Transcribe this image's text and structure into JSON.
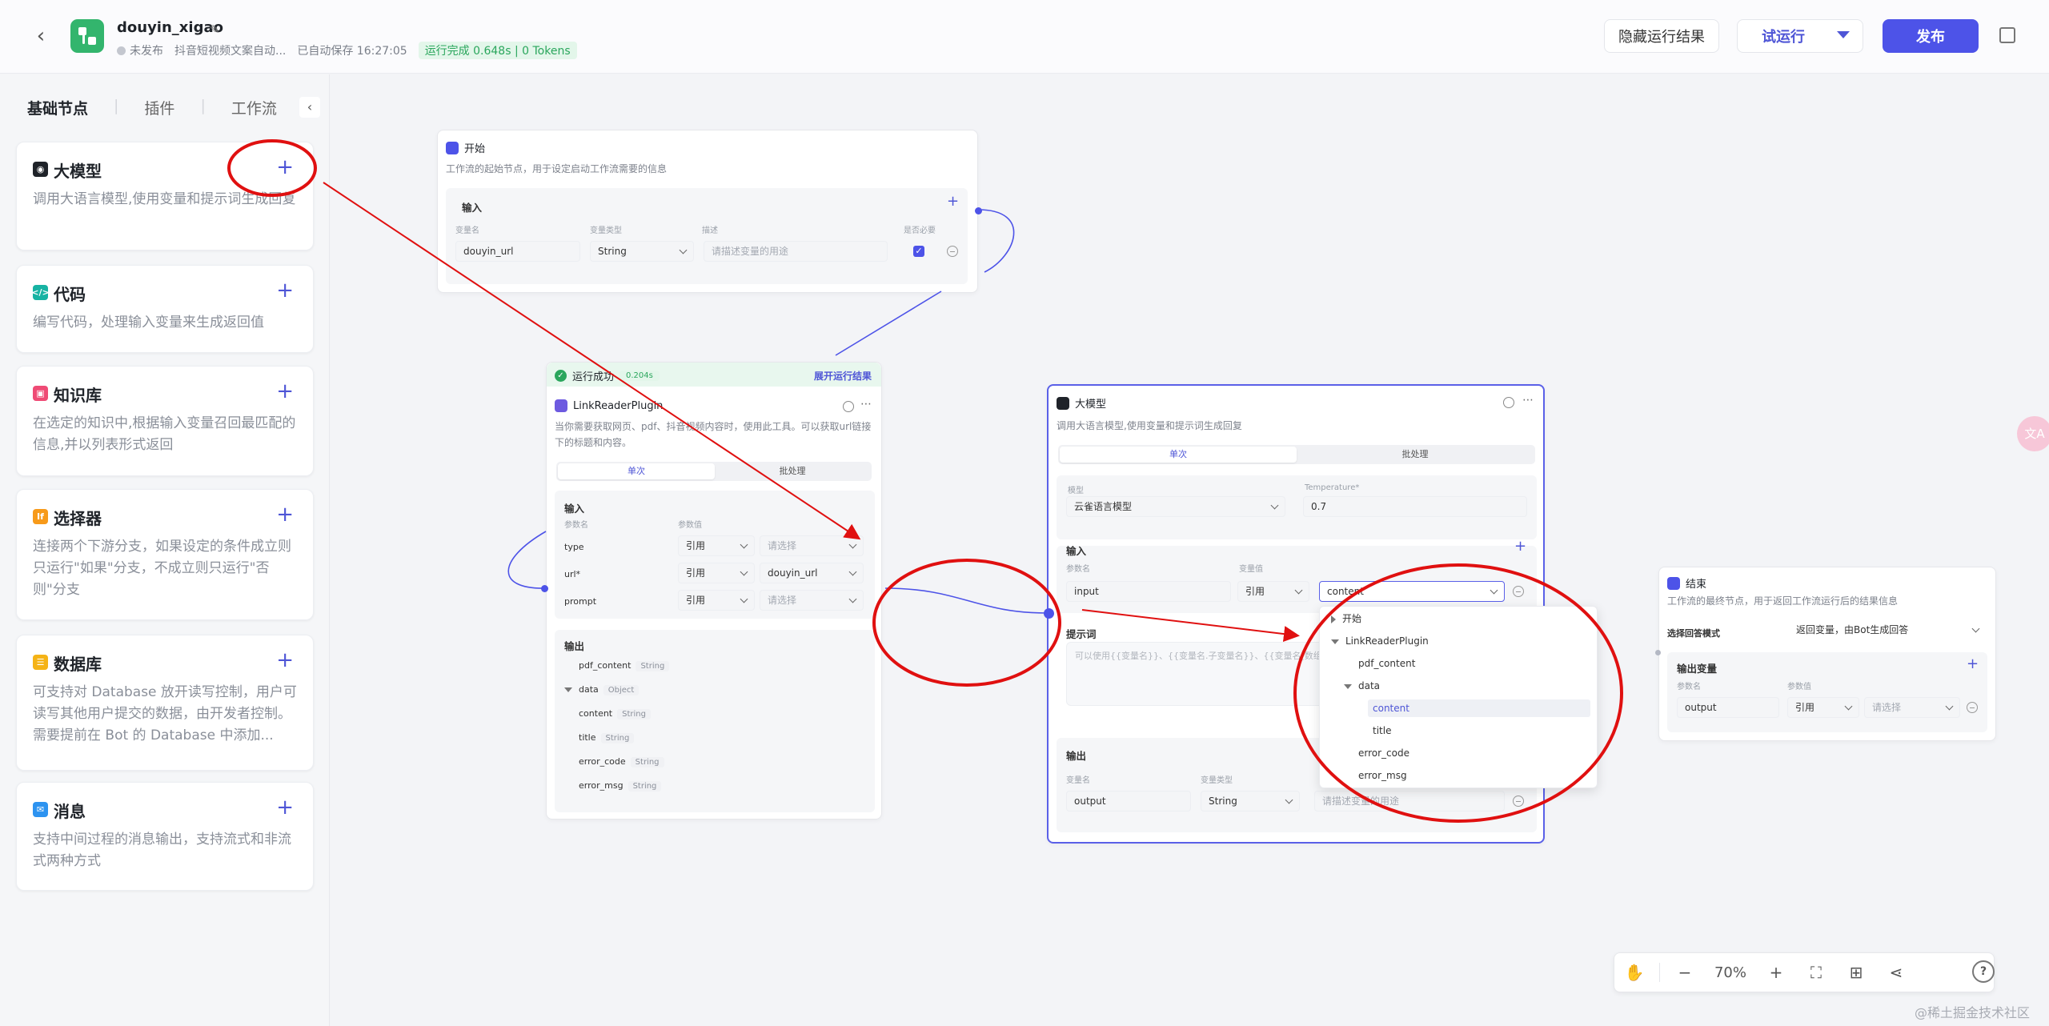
{
  "header": {
    "back": "‹",
    "app_name": "douyin_xigao",
    "status": "未发布",
    "description": "抖音短视频文案自动...",
    "autosave": "已自动保存 16:27:05",
    "run_result": "运行完成 0.648s | 0 Tokens",
    "hide_results": "隐藏运行结果",
    "test_run": "试运行",
    "publish": "发布"
  },
  "left_panel": {
    "tabs": [
      "基础节点",
      "插件",
      "工作流"
    ],
    "nodes": [
      {
        "title": "大模型",
        "desc": "调用大语言模型,使用变量和提示词生成回复",
        "icon": "llm-icon",
        "color": "#1f2329"
      },
      {
        "title": "代码",
        "desc": "编写代码，处理输入变量来生成返回值",
        "icon": "code-icon",
        "color": "#17b3a3"
      },
      {
        "title": "知识库",
        "desc": "在选定的知识中,根据输入变量召回最匹配的信息,并以列表形式返回",
        "icon": "knowledge-icon",
        "color": "#ef4b75"
      },
      {
        "title": "选择器",
        "desc": "连接两个下游分支，如果设定的条件成立则只运行\"如果\"分支，不成立则只运行\"否则\"分支",
        "icon": "if-icon",
        "color": "#f79a1a"
      },
      {
        "title": "数据库",
        "desc": "可支持对 Database 放开读写控制，用户可读写其他用户提交的数据，由开发者控制。需要提前在 Bot 的 Database 中添加...",
        "icon": "database-icon",
        "color": "#f5b316"
      },
      {
        "title": "消息",
        "desc": "支持中间过程的消息输出，支持流式和非流式两种方式",
        "icon": "message-icon",
        "color": "#2d93f0"
      }
    ]
  },
  "start_node": {
    "title": "开始",
    "desc": "工作流的起始节点，用于设定启动工作流需要的信息",
    "input_label": "输入",
    "col_name": "变量名",
    "col_type": "变量类型",
    "col_desc": "描述",
    "col_required": "是否必要",
    "var_name": "douyin_url",
    "var_type": "String",
    "var_desc_placeholder": "请描述变量的用途"
  },
  "plugin_node": {
    "run_status": "运行成功",
    "run_time": "0.204s",
    "expand": "展开运行结果",
    "title": "LinkReaderPlugin",
    "desc": "当你需要获取网页、pdf、抖音视频内容时，使用此工具。可以获取url链接下的标题和内容。",
    "tab_single": "单次",
    "tab_batch": "批处理",
    "input_label": "输入",
    "col_name": "参数名",
    "col_value": "参数值",
    "params": [
      {
        "name": "type",
        "mode": "引用",
        "value": "请选择",
        "placeholder": true
      },
      {
        "name": "url*",
        "mode": "引用",
        "value": "douyin_url",
        "placeholder": false
      },
      {
        "name": "prompt",
        "mode": "引用",
        "value": "请选择",
        "placeholder": true
      }
    ],
    "output_label": "输出",
    "outputs": [
      {
        "name": "pdf_content",
        "type": "String",
        "indent": 0,
        "caret": false
      },
      {
        "name": "data",
        "type": "Object",
        "indent": 0,
        "caret": true
      },
      {
        "name": "content",
        "type": "String",
        "indent": 1,
        "caret": false
      },
      {
        "name": "title",
        "type": "String",
        "indent": 1,
        "caret": false
      },
      {
        "name": "error_code",
        "type": "String",
        "indent": 1,
        "caret": false
      },
      {
        "name": "error_msg",
        "type": "String",
        "indent": 1,
        "caret": false
      }
    ]
  },
  "llm_node": {
    "title": "大模型",
    "desc": "调用大语言模型,使用变量和提示词生成回复",
    "tab_single": "单次",
    "tab_batch": "批处理",
    "model_label": "模型",
    "model_value": "云雀语言模型",
    "temp_label": "Temperature*",
    "temp_value": "0.7",
    "input_label": "输入",
    "col_name": "参数名",
    "col_value": "变量值",
    "input_name": "input",
    "input_mode": "引用",
    "input_value": "content",
    "prompt_label": "提示词",
    "prompt_placeholder": "可以使用{{变量名}}、{{变量名.子变量名}}、{{变量名[数组]}}",
    "output_label": "输出",
    "out_col_name": "变量名",
    "out_col_type": "变量类型",
    "out_name": "output",
    "out_type": "String",
    "out_desc_placeholder": "请描述变量的用途"
  },
  "dropdown": {
    "items": [
      {
        "label": "开始",
        "indent": 0,
        "caret": "right",
        "selected": false
      },
      {
        "label": "LinkReaderPlugin",
        "indent": 0,
        "caret": "down",
        "selected": false
      },
      {
        "label": "pdf_content",
        "indent": 1,
        "caret": "",
        "selected": false
      },
      {
        "label": "data",
        "indent": 1,
        "caret": "down",
        "selected": false
      },
      {
        "label": "content",
        "indent": 2,
        "caret": "",
        "selected": true
      },
      {
        "label": "title",
        "indent": 2,
        "caret": "",
        "selected": false
      },
      {
        "label": "error_code",
        "indent": 1,
        "caret": "",
        "selected": false
      },
      {
        "label": "error_msg",
        "indent": 1,
        "caret": "",
        "selected": false
      }
    ]
  },
  "end_node": {
    "title": "结束",
    "desc": "工作流的最终节点，用于返回工作流运行后的结果信息",
    "mode_label": "选择回答模式",
    "mode_value": "返回变量，由Bot生成回答",
    "output_label": "输出变量",
    "col_name": "参数名",
    "col_value": "参数值",
    "var_name": "output",
    "var_mode": "引用",
    "var_value": "请选择"
  },
  "zoom": {
    "value": "70%"
  },
  "watermark": "@稀土掘金技术社区",
  "colors": {
    "accent": "#4d53e8",
    "annotation": "#e01010",
    "success": "#2aa65c"
  }
}
